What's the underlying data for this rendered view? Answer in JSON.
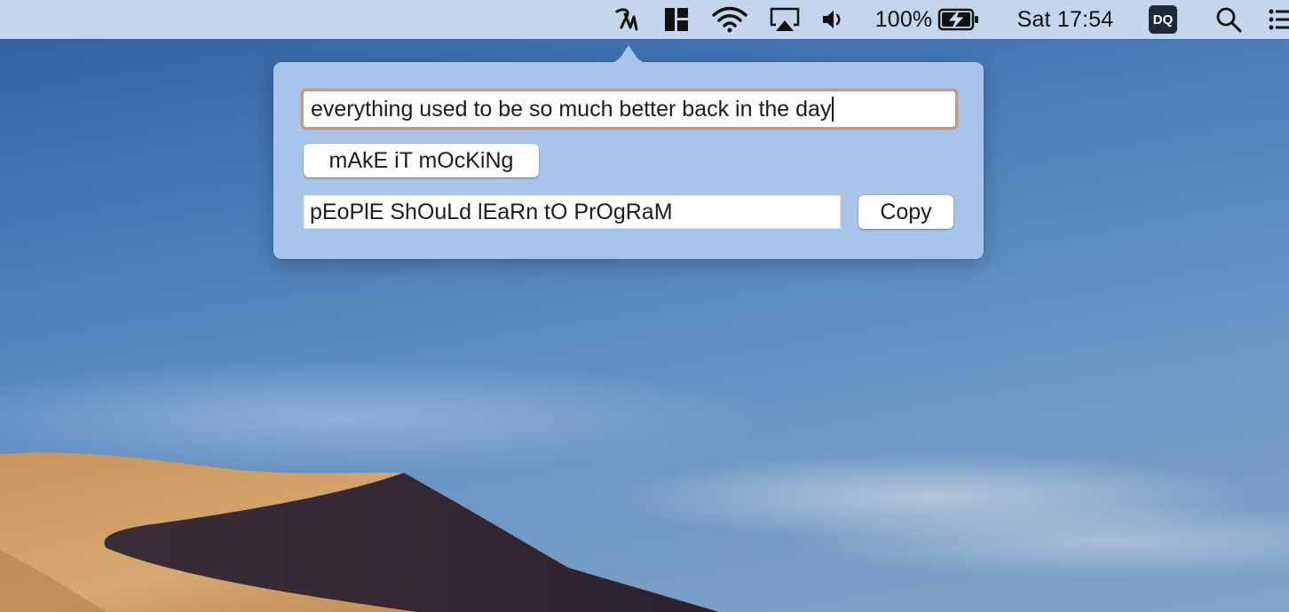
{
  "menubar": {
    "app_icon": "mocking-app-icon",
    "battery_percent": "100%",
    "clock": "Sat 17:54",
    "profile_initials": "DQ",
    "icons": [
      "layout-grid-icon",
      "wifi-icon",
      "airplay-icon",
      "volume-icon",
      "battery-charging-icon",
      "search-icon",
      "control-list-icon"
    ]
  },
  "popover": {
    "input_text": "everything used to be so much better back in the day",
    "make_button_label": "mAkE iT mOcKiNg",
    "output_text": "pEoPlE ShOuLd lEaRn tO PrOgRaM",
    "copy_button_label": "Copy"
  },
  "colors": {
    "popover_bg": "#a7c4ea",
    "focus_ring": "#c89a86",
    "menubar_bg": "#cddef2"
  }
}
